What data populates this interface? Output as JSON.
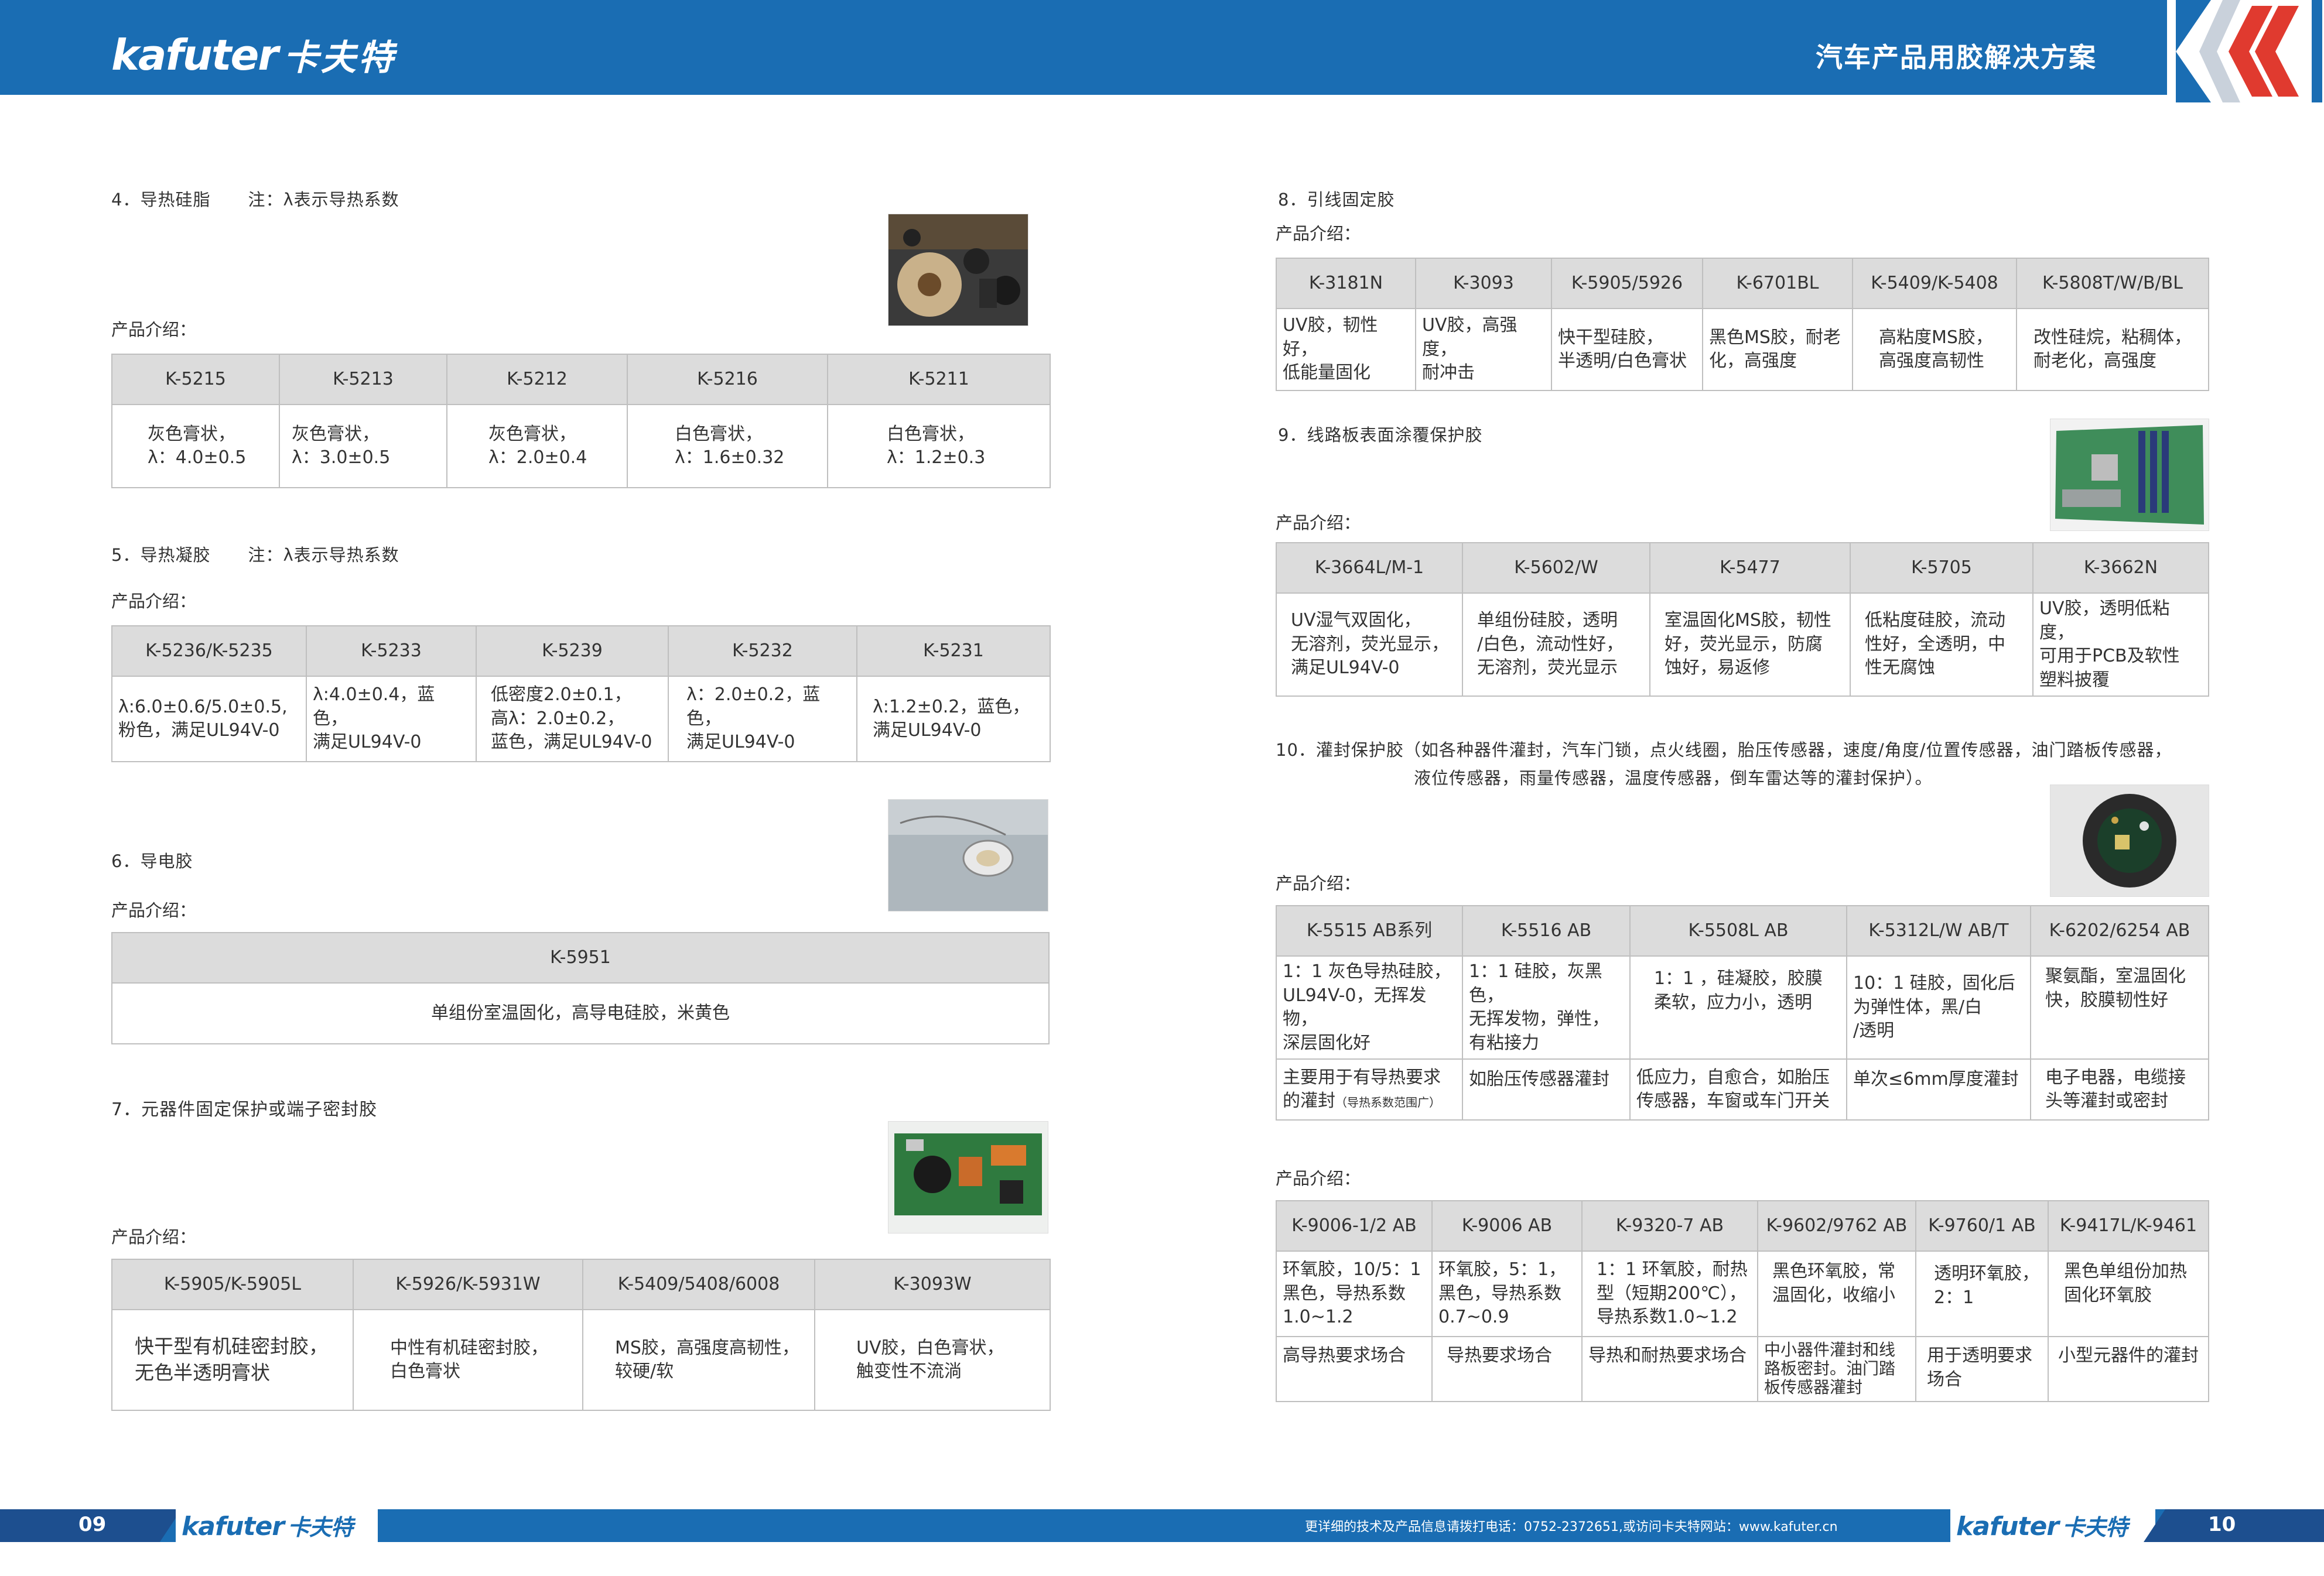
{
  "header": {
    "brand": "kafuter",
    "brand_cn": "卡夫特",
    "title": "汽车产品用胶解决方案"
  },
  "footer": {
    "page_left": "09",
    "page_right": "10",
    "brand": "kafuter",
    "brand_cn": "卡夫特",
    "contact": "更详细的技术及产品信息请拨打电话：0752-2372651,或访问卡夫特网站：www.kafuter.cn"
  },
  "label_intro": "产品介绍：",
  "sec4": {
    "title": "4．导热硅脂",
    "note": "注：λ表示导热系数",
    "cols": [
      "K-5215",
      "K-5213",
      "K-5212",
      "K-5216",
      "K-5211"
    ],
    "row": [
      [
        "灰色膏状，",
        "λ：4.0±0.5"
      ],
      [
        "灰色膏状，",
        "λ：3.0±0.5"
      ],
      [
        "灰色膏状，",
        "λ：2.0±0.4"
      ],
      [
        "白色膏状，",
        "λ：1.6±0.32"
      ],
      [
        "白色膏状，",
        "λ：1.2±0.3"
      ]
    ]
  },
  "sec5": {
    "title": "5．导热凝胶",
    "note": "注：λ表示导热系数",
    "cols": [
      "K-5236/K-5235",
      "K-5233",
      "K-5239",
      "K-5232",
      "K-5231"
    ],
    "row": [
      [
        "λ:6.0±0.6/5.0±0.5,",
        "粉色，满足UL94V-0"
      ],
      [
        "λ:4.0±0.4，蓝色，",
        "满足UL94V-0"
      ],
      [
        "低密度2.0±0.1，",
        "高λ：2.0±0.2，",
        "蓝色，满足UL94V-0"
      ],
      [
        "λ：2.0±0.2，蓝色，",
        "满足UL94V-0"
      ],
      [
        "λ:1.2±0.2，蓝色，",
        "满足UL94V-0"
      ]
    ]
  },
  "sec6": {
    "title": "6．导电胶",
    "col": "K-5951",
    "row": "单组份室温固化，高导电硅胶，米黄色"
  },
  "sec7": {
    "title": "7．元器件固定保护或端子密封胶",
    "cols": [
      "K-5905/K-5905L",
      "K-5926/K-5931W",
      "K-5409/5408/6008",
      "K-3093W"
    ],
    "row": [
      [
        "快干型有机硅密封胶，",
        "无色半透明膏状"
      ],
      [
        "中性有机硅密封胶，",
        "白色膏状"
      ],
      [
        "MS胶，高强度高韧性，",
        "较硬/软"
      ],
      [
        "UV胶，白色膏状，",
        "触变性不流淌"
      ]
    ]
  },
  "sec8": {
    "title": "8．引线固定胶",
    "cols": [
      "K-3181N",
      "K-3093",
      "K-5905/5926",
      "K-6701BL",
      "K-5409/K-5408",
      "K-5808T/W/B/BL"
    ],
    "row": [
      [
        "UV胶，韧性好，",
        "低能量固化"
      ],
      [
        "UV胶，高强度，",
        "耐冲击"
      ],
      [
        "快干型硅胶，",
        "半透明/白色膏状"
      ],
      [
        "黑色MS胶，耐老",
        "化，高强度"
      ],
      [
        "高粘度MS胶，",
        "高强度高韧性"
      ],
      [
        "改性硅烷，粘稠体，",
        "耐老化，高强度"
      ]
    ]
  },
  "sec9": {
    "title": "9．线路板表面涂覆保护胶",
    "cols": [
      "K-3664L/M-1",
      "K-5602/W",
      "K-5477",
      "K-5705",
      "K-3662N"
    ],
    "row": [
      [
        "UV湿气双固化，",
        "无溶剂，荧光显示，",
        "满足UL94V-0"
      ],
      [
        "单组份硅胶，透明",
        "/白色，流动性好，",
        "无溶剂，荧光显示"
      ],
      [
        "室温固化MS胶，韧性",
        "好，荧光显示，防腐",
        "蚀好，易返修"
      ],
      [
        "低粘度硅胶，流动",
        "性好，全透明，中",
        "性无腐蚀"
      ],
      [
        "UV胶，透明低粘度，",
        "可用于PCB及软性",
        "塑料披覆"
      ]
    ]
  },
  "sec10": {
    "title_line1": "10．灌封保护胶（如各种器件灌封，汽车门锁，点火线圈，胎压传感器，速度/角度/位置传感器，油门踏板传感器，",
    "title_line2": "液位传感器，雨量传感器，温度传感器，倒车雷达等的灌封保护）。",
    "table1": {
      "cols": [
        "K-5515 AB系列",
        "K-5516 AB",
        "K-5508L AB",
        "K-5312L/W AB/T",
        "K-6202/6254 AB"
      ],
      "row1": [
        [
          "1：1 灰色导热硅胶，",
          "UL94V-0，无挥发物，",
          "深层固化好"
        ],
        [
          "1：1 硅胶，灰黑色，",
          "无挥发物，弹性，",
          "有粘接力"
        ],
        [
          "1：1 ，硅凝胶，胶膜",
          "柔软，应力小，透明"
        ],
        [
          "10：1 硅胶，固化后",
          "为弹性体，黑/白",
          "/透明"
        ],
        [
          "聚氨酯，室温固化",
          "快，胶膜韧性好"
        ]
      ],
      "row2_first": "主要用于有导热要求",
      "row2_first_b": "的灌封",
      "row2_first_small": "（导热系数范围广）",
      "row2": [
        [
          "如胎压传感器灌封"
        ],
        [
          "低应力，自愈合，如胎压",
          "传感器，车窗或车门开关"
        ],
        [
          "单次≤6mm厚度灌封"
        ],
        [
          "电子电器，电缆接",
          "头等灌封或密封"
        ]
      ]
    },
    "table2": {
      "cols": [
        "K-9006-1/2 AB",
        "K-9006 AB",
        "K-9320-7 AB",
        "K-9602/9762 AB",
        "K-9760/1 AB",
        "K-9417L/K-9461"
      ],
      "row1": [
        [
          "环氧胶，10/5：1",
          "黑色，导热系数",
          "1.0~1.2"
        ],
        [
          "环氧胶，5：1，",
          "黑色，导热系数",
          "0.7~0.9"
        ],
        [
          "1：1 环氧胶，耐热",
          "型（短期200℃），",
          "导热系数1.0~1.2"
        ],
        [
          "黑色环氧胶，常",
          "温固化，收缩小"
        ],
        [
          "透明环氧胶，",
          "2：1"
        ],
        [
          "黑色单组份加热",
          "固化环氧胶"
        ]
      ],
      "row2": [
        [
          "高导热要求场合"
        ],
        [
          "导热要求场合"
        ],
        [
          "导热和耐热要求场合"
        ],
        [
          "中小器件灌封和线",
          "路板密封。油门踏",
          "板传感器灌封"
        ],
        [
          "用于透明要求",
          "场合"
        ],
        [
          "小型元器件的灌封"
        ]
      ]
    }
  },
  "colors": {
    "header_blue": "#1a6db3",
    "dark_blue": "#1d4f8f",
    "accent_red": "#e03a2f",
    "table_header": "#dcdcdc"
  }
}
